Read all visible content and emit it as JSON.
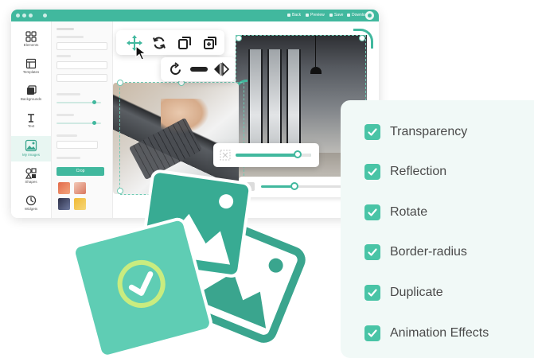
{
  "colors": {
    "accent": "#41b89e",
    "accent_light": "#49c4a6",
    "panel_bg": "#f1f9f7",
    "card_green": "#5fcdb4",
    "card_dark": "#3aa58e",
    "check_ring": "#c9ec7f"
  },
  "editor": {
    "topbar": {
      "buttons": [
        "Back",
        "Preview",
        "Save",
        "Download"
      ]
    },
    "rail": {
      "items": [
        {
          "label": "Elements",
          "icon": "grid-icon"
        },
        {
          "label": "Templates",
          "icon": "template-icon"
        },
        {
          "label": "Backgrounds",
          "icon": "background-icon"
        },
        {
          "label": "Text",
          "icon": "text-icon"
        },
        {
          "label": "My Images",
          "icon": "image-icon"
        },
        {
          "label": "Shapes",
          "icon": "shapes-icon"
        },
        {
          "label": "Widgets",
          "icon": "widget-icon"
        }
      ],
      "active_index": 4
    },
    "props": {
      "apply_label": "Crop"
    }
  },
  "toolbar_primary": [
    {
      "name": "move-icon",
      "active": true
    },
    {
      "name": "replace-icon",
      "active": false
    },
    {
      "name": "duplicate-icon",
      "active": false
    },
    {
      "name": "layers-icon",
      "active": false
    }
  ],
  "toolbar_secondary": [
    {
      "name": "rotate-icon"
    },
    {
      "name": "border-radius-icon"
    },
    {
      "name": "flip-icon"
    }
  ],
  "sliders": {
    "transparency_value": 0.82,
    "secondary_value": 0.38
  },
  "features": [
    {
      "label": "Transparency",
      "checked": true
    },
    {
      "label": "Reflection",
      "checked": true
    },
    {
      "label": "Rotate",
      "checked": true
    },
    {
      "label": "Border-radius",
      "checked": true
    },
    {
      "label": "Duplicate",
      "checked": true
    },
    {
      "label": "Animation Effects",
      "checked": true
    }
  ]
}
